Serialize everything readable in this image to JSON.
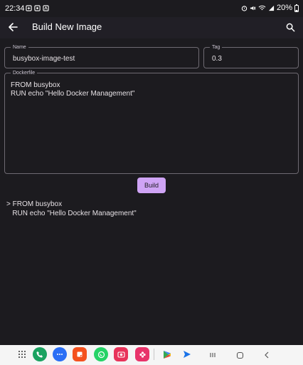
{
  "status_bar": {
    "time": "22:34",
    "battery": "20%"
  },
  "app_bar": {
    "title": "Build New Image",
    "back_icon": "arrow-back-icon",
    "search_icon": "search-icon"
  },
  "form": {
    "name": {
      "label": "Name",
      "value": "busybox-image-test"
    },
    "tag": {
      "label": "Tag",
      "value": "0.3"
    },
    "dockerfile": {
      "label": "Dockerfile",
      "value": "FROM busybox\nRUN echo \"Hello Docker Management\""
    },
    "build_button": "Build"
  },
  "output": {
    "text": "> FROM busybox\n   RUN echo \"Hello Docker Management\""
  },
  "nav_bar": {
    "apps": [
      "app-drawer-icon",
      "phone-icon",
      "messages-icon",
      "notes-icon",
      "whatsapp-icon",
      "camera-icon",
      "flower-app-icon",
      "play-store-icon",
      "send-app-icon"
    ],
    "system": [
      "recents-icon",
      "home-icon",
      "back-icon"
    ]
  },
  "colors": {
    "background": "#1c1b1f",
    "app_bar": "#211f26",
    "accent": "#cfa4f5",
    "outline": "#6e6a72"
  }
}
